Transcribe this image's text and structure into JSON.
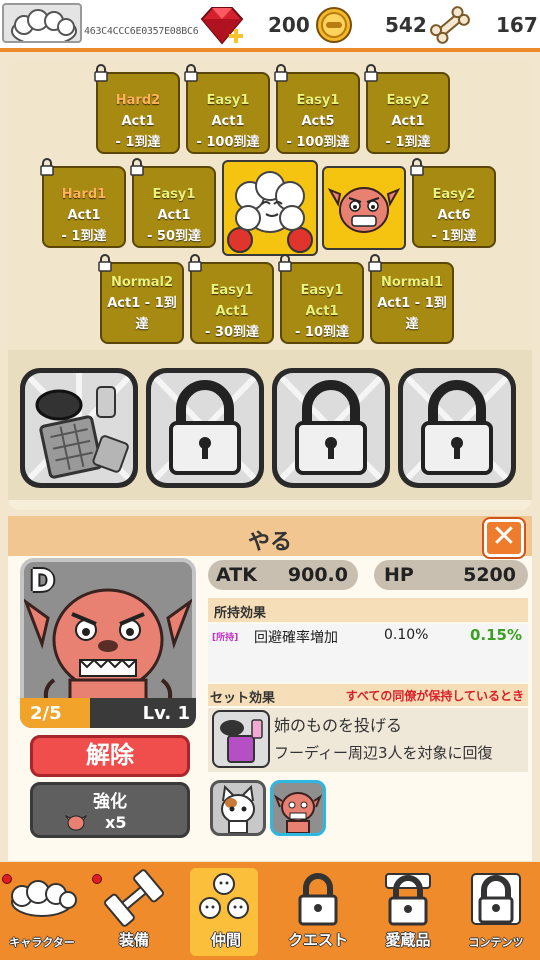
{
  "top": {
    "user_id": "463C4CCC6E0357E08BC6",
    "gems": "200",
    "coins": "542",
    "bones": "167"
  },
  "map": {
    "row1": [
      {
        "diff": "Hard2",
        "act": "Act1",
        "goal": "- 1到達"
      },
      {
        "diff": "Easy1",
        "act": "Act1",
        "goal": "- 100到達"
      },
      {
        "diff": "Easy1",
        "act": "Act5",
        "goal": "- 100到達"
      },
      {
        "diff": "Easy2",
        "act": "Act1",
        "goal": "- 1到達"
      }
    ],
    "row2": [
      {
        "diff": "Hard1",
        "act": "Act1",
        "goal": "- 1到達"
      },
      {
        "diff": "Easy1",
        "act": "Act1",
        "goal": "- 50到達"
      },
      {
        "diff": "Easy2",
        "act": "Act6",
        "goal": "- 1到達"
      }
    ],
    "row3": [
      {
        "line1": "Normal2",
        "line2": "Act1 - 1到",
        "line3": "達"
      },
      {
        "line1": "Easy1 Act1",
        "line2": "- 30到達",
        "line3": ""
      },
      {
        "line1": "Easy1 Act1",
        "line2": "- 10到達",
        "line3": ""
      },
      {
        "line1": "Normal1",
        "line2": "Act1 - 1到",
        "line3": "達"
      }
    ]
  },
  "detail": {
    "name": "やる",
    "close": "✕",
    "rank": "D",
    "count": "2/5",
    "count_fraction": 0.4,
    "level": "Lv. 1",
    "release": "解除",
    "upgrade": "強化",
    "upgrade_cost": "x5",
    "atk_label": "ATK",
    "atk_value": "900.0",
    "hp_label": "HP",
    "hp_value": "5200",
    "owned_effect_title": "所持効果",
    "effect_tag": "[所持]",
    "effect_name": "回避確率増加",
    "effect_value": "0.10%",
    "effect_next": "0.15%",
    "set_title": "セット効果",
    "set_condition": "すべての同僚が保持しているとき",
    "set_name": "姉のものを投げる",
    "set_desc": "フーディー周辺3人を対象に回復"
  },
  "nav": [
    {
      "label": "キャラクター"
    },
    {
      "label": "装備"
    },
    {
      "label": "仲間"
    },
    {
      "label": "クエスト"
    },
    {
      "label": "愛蔵品"
    },
    {
      "label": "コンテンツ"
    }
  ],
  "colors": {
    "accent": "#ef8b2b",
    "node": "#a78a12",
    "release": "#f04d4d",
    "effect_next": "#3aa020"
  }
}
